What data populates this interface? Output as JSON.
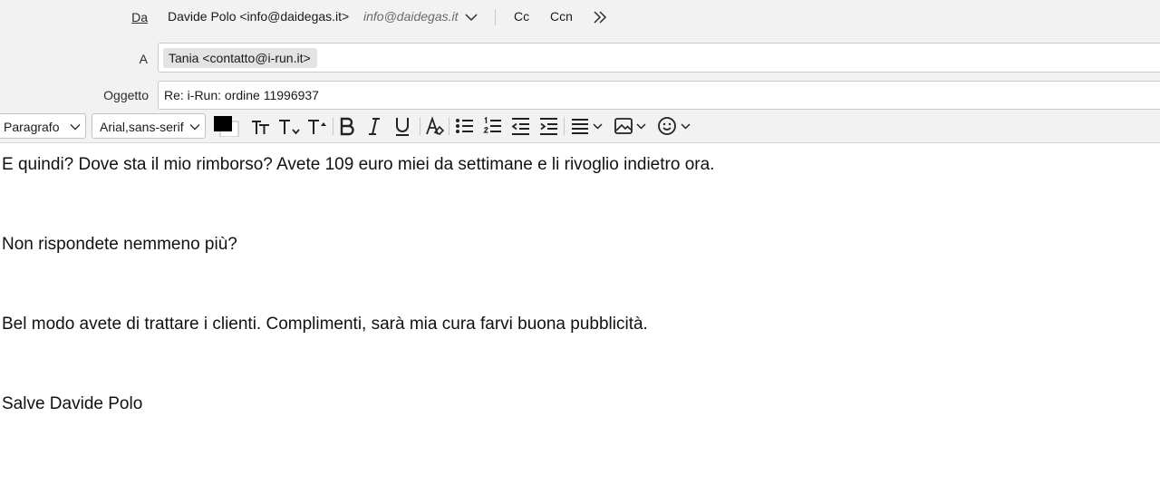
{
  "header": {
    "from_label": "Da",
    "from_value": "Davide Polo <info@daidegas.it>",
    "from_identity": "info@daidegas.it",
    "cc_label": "Cc",
    "ccn_label": "Ccn",
    "to_label": "A",
    "to_recipients": [
      "Tania <contatto@i-run.it>"
    ],
    "subject_label": "Oggetto",
    "subject_value": "Re: i-Run: ordine 11996937"
  },
  "toolbar": {
    "paragraph_format": "Paragrafo",
    "font_family": "Arial,sans-serif",
    "text_color": "#000000",
    "icons": [
      "text-color-swatch-icon",
      "font-size-icon",
      "decrease-size-icon",
      "increase-size-icon",
      "bold-icon",
      "italic-icon",
      "underline-icon",
      "clear-format-icon",
      "bullet-list-icon",
      "numbered-list-icon",
      "outdent-icon",
      "indent-icon",
      "align-icon",
      "insert-image-icon",
      "emoji-icon"
    ]
  },
  "body": {
    "paragraphs": [
      "E quindi? Dove sta il mio rimborso? Avete 109 euro miei da settimane e li rivoglio indietro ora.",
      "Non rispondete nemmeno più?",
      "Bel modo avete di trattare i clienti. Complimenti, sarà mia cura farvi buona pubblicità.",
      "Salve Davide Polo"
    ]
  }
}
